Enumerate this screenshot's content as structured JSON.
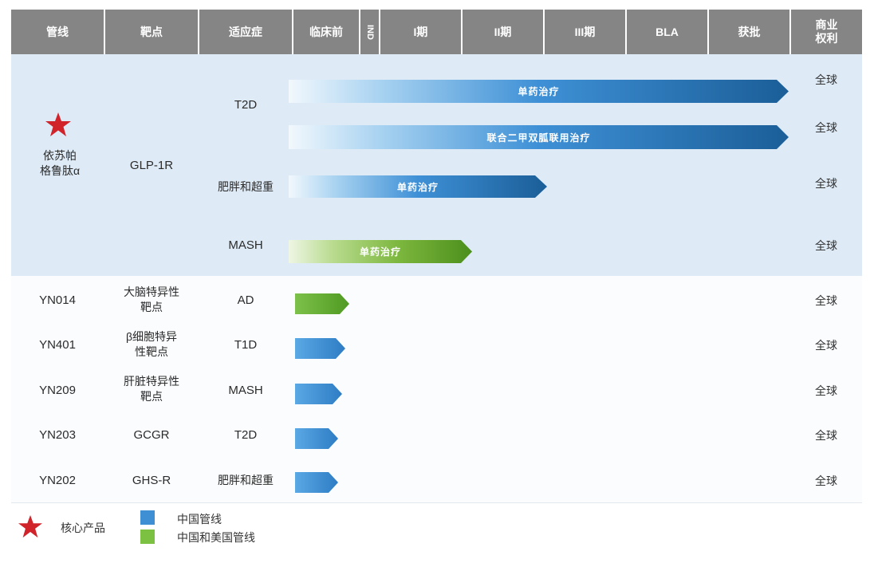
{
  "headers": [
    "管线",
    "靶点",
    "适应症",
    "临床前",
    "IND",
    "I期",
    "II期",
    "III期",
    "BLA",
    "获批",
    "商业\n权利"
  ],
  "core_product": {
    "name": "依苏帕\n格鲁肽α",
    "target": "GLP-1R",
    "indications": [
      {
        "name": "T2D",
        "bars": [
          {
            "label": "单药治疗",
            "color": "blue",
            "rights": "全球"
          },
          {
            "label": "联合二甲双胍联用治疗",
            "color": "blue",
            "rights": "全球"
          }
        ]
      },
      {
        "name": "肥胖和超重",
        "bars": [
          {
            "label": "单药治疗",
            "color": "blue",
            "rights": "全球"
          }
        ]
      },
      {
        "name": "MASH",
        "bars": [
          {
            "label": "单药治疗",
            "color": "green",
            "rights": "全球"
          }
        ]
      }
    ]
  },
  "pipeline_rows": [
    {
      "pipeline": "YN014",
      "target": "大脑特异性\n靶点",
      "indication": "AD",
      "color": "green",
      "rights": "全球"
    },
    {
      "pipeline": "YN401",
      "target": "β细胞特异\n性靶点",
      "indication": "T1D",
      "color": "blue",
      "rights": "全球"
    },
    {
      "pipeline": "YN209",
      "target": "肝脏特异性\n靶点",
      "indication": "MASH",
      "color": "blue",
      "rights": "全球"
    },
    {
      "pipeline": "YN203",
      "target": "GCGR",
      "indication": "T2D",
      "color": "blue",
      "rights": "全球"
    },
    {
      "pipeline": "YN202",
      "target": "GHS-R",
      "indication": "肥胖和超重",
      "color": "blue",
      "rights": "全球"
    }
  ],
  "legend": [
    {
      "icon": "star-icon",
      "label": "核心产品"
    },
    {
      "swatch": "blue",
      "label": "中国管线"
    },
    {
      "swatch": "green",
      "label": "中国和美国管线"
    }
  ],
  "colors": {
    "header": "#858585",
    "band": "#deebf7",
    "blue": "#2e7cc4",
    "green": "#6cae35",
    "star": "#d0232a"
  }
}
